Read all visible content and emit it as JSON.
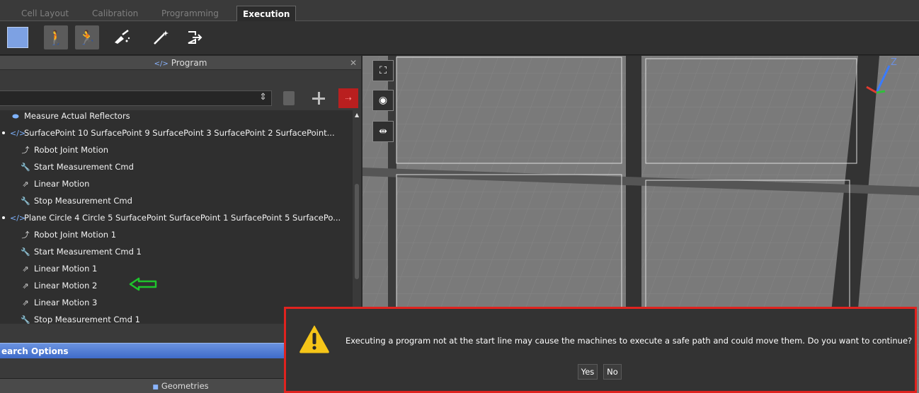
{
  "tabs": [
    {
      "label": "Cell Layout",
      "active": false
    },
    {
      "label": "Calibration",
      "active": false
    },
    {
      "label": "Programming",
      "active": false
    },
    {
      "label": "Execution",
      "active": true
    }
  ],
  "toolbar": {
    "icons": [
      "stop-square-icon",
      "walk-icon",
      "run-icon",
      "sweep-icon",
      "wand-icon",
      "pen-icon",
      "exit-icon"
    ]
  },
  "program_panel": {
    "title": "Program",
    "close_glyph": "✕",
    "combo_value": "",
    "items": [
      {
        "label": "Measure Actual Reflectors",
        "icon": "reflector-icon"
      },
      {
        "label": "SurfacePoint 10 SurfacePoint 9 SurfacePoint 3 SurfacePoint 2 SurfacePoint...",
        "icon": "code-icon"
      },
      {
        "label": "Robot Joint Motion",
        "icon": "joint-motion-icon"
      },
      {
        "label": "Start Measurement Cmd",
        "icon": "measurement-cmd-icon"
      },
      {
        "label": "Linear Motion",
        "icon": "linear-motion-icon"
      },
      {
        "label": "Stop Measurement Cmd",
        "icon": "measurement-cmd-icon"
      },
      {
        "label": "Plane Circle 4 Circle 5 SurfacePoint SurfacePoint 1 SurfacePoint 5 SurfacePo...",
        "icon": "code-icon"
      },
      {
        "label": "Robot Joint Motion 1",
        "icon": "joint-motion-icon"
      },
      {
        "label": "Start Measurement Cmd 1",
        "icon": "measurement-cmd-icon"
      },
      {
        "label": "Linear Motion 1",
        "icon": "linear-motion-icon"
      },
      {
        "label": "Linear Motion 2",
        "icon": "linear-motion-icon"
      },
      {
        "label": "Linear Motion 3",
        "icon": "linear-motion-icon"
      },
      {
        "label": "Stop Measurement Cmd 1",
        "icon": "measurement-cmd-icon"
      }
    ],
    "search_options_label": "earch Options",
    "geometries_label": "Geometries"
  },
  "viewport": {
    "axis_label": "Z",
    "tools": [
      "fit-view-icon",
      "camera-icon",
      "split-view-icon"
    ]
  },
  "dialog": {
    "message": "Executing a program not at the start line may cause the machines to execute a safe path and could move them. Do you want to continue?",
    "yes_label": "Yes",
    "no_label": "No",
    "colors": {
      "border": "#e0231f",
      "warning": "#f5c518"
    }
  }
}
